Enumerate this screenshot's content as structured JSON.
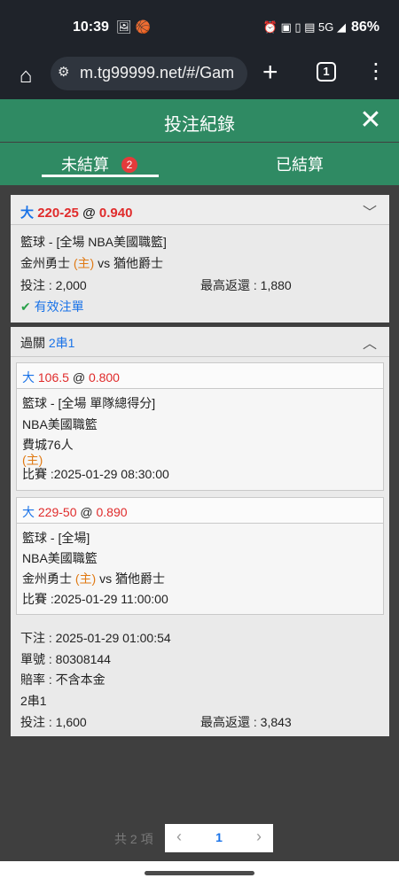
{
  "statusbar": {
    "time": "10:39",
    "left_icons": "🖼 🏀",
    "right_icons": "⏰ ▣ ▯ ▤ 5G ◢",
    "battery": "86%"
  },
  "browser": {
    "url": "m.tg99999.net/#/Gam",
    "tab_count": "1"
  },
  "header": {
    "title": "投注紀錄"
  },
  "tabs": [
    {
      "label": "未結算",
      "badge": "2"
    },
    {
      "label": "已結算"
    }
  ],
  "bet1": {
    "pick": "大",
    "line": "220-25",
    "at": "@",
    "odds": "0.940",
    "league_line": "籃球 - [全場 NBA美國職籃]",
    "home_team": "金州勇士",
    "home_tag": "(主)",
    "vs": "vs",
    "away_team": "猶他爵士",
    "stake": "投注 : 2,000",
    "max_return": "最高返還 : 1,880",
    "status": "有效注單"
  },
  "parlay": {
    "label": "過關",
    "type": "2串1",
    "leg1": {
      "pick": "大",
      "line": "106.5",
      "at": "@",
      "odds": "0.800",
      "market": "籃球 - [全場 單隊總得分]",
      "league": "NBA美國職籃",
      "team": "費城76人",
      "team_tag": "(主)",
      "match_time": "比賽 :2025-01-29 08:30:00"
    },
    "leg2": {
      "pick": "大",
      "line": "229-50",
      "at": "@",
      "odds": "0.890",
      "market": "籃球 - [全場]",
      "league": "NBA美國職籃",
      "home_team": "金州勇士",
      "home_tag": "(主)",
      "vs": "vs",
      "away_team": "猶他爵士",
      "match_time": "比賽 :2025-01-29 11:00:00"
    },
    "placed": "下注 : 2025-01-29 01:00:54",
    "ticket": "單號 : 80308144",
    "odds_note": "賠率 : 不含本金",
    "type_again": "2串1",
    "stake": "投注 : 1,600",
    "max_return": "最高返還 : 3,843"
  },
  "pager": {
    "total": "共 2 項",
    "page": "1"
  },
  "colors": {
    "header_green": "#2f8a63",
    "odds_red": "#e02b2b",
    "pick_blue": "#1a73e8",
    "home_orange": "#e07a14"
  }
}
